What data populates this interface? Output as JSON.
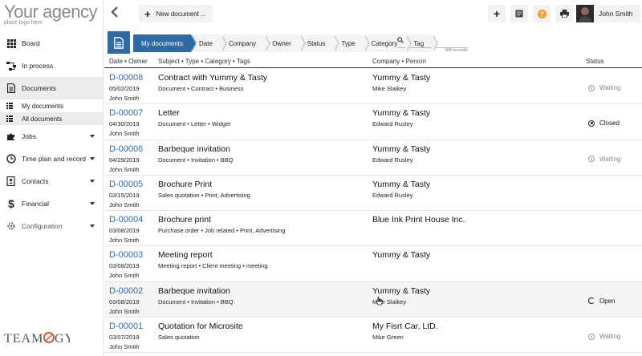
{
  "brand": {
    "name": "Your agency",
    "subtitle": "place logo here"
  },
  "sidebar": {
    "items": [
      {
        "label": "Board",
        "icon": "grid-icon"
      },
      {
        "label": "In process",
        "icon": "flow-icon"
      },
      {
        "label": "Documents",
        "icon": "document-icon",
        "active": true
      },
      {
        "label": "Jobs",
        "icon": "puzzle-icon"
      },
      {
        "label": "Time plan and record",
        "icon": "clock-icon"
      },
      {
        "label": "Contacts",
        "icon": "contacts-icon"
      },
      {
        "label": "Financial",
        "icon": "dollar-icon"
      },
      {
        "label": "Configuration",
        "icon": "gear-icon"
      }
    ],
    "subitems": [
      {
        "label": "My documents"
      },
      {
        "label": "All documents",
        "active": true
      }
    ],
    "footer_logo": "TEAMOGY"
  },
  "topbar": {
    "new_document_label": "New document ...",
    "user_name": "John Smith"
  },
  "filters": {
    "crumbs": [
      "My documents",
      "Date",
      "Company",
      "Owner",
      "Status",
      "Type",
      "Category",
      "Tag"
    ],
    "records": "8/8 records"
  },
  "table": {
    "headers": {
      "col1": "Date • Owner",
      "col2": "Subject • Type • Category • Tags",
      "col3": "Company • Person",
      "col4": "Status"
    },
    "rows": [
      {
        "id": "D-00008",
        "date": "05/02/2019",
        "owner": "John Smith",
        "subject": "Contract with Yummy & Tasty",
        "meta": "Document • Contract • Business",
        "company": "Yummy & Tasty",
        "person": "Mike Slaikey",
        "status": "Waiting",
        "status_kind": "waiting"
      },
      {
        "id": "D-00007",
        "date": "04/30/2019",
        "owner": "John Smith",
        "subject": "Letter",
        "meta": "Document • Letter • Widget",
        "company": "Yummy & Tasty",
        "person": "Edward Rusley",
        "status": "Closed",
        "status_kind": "closed"
      },
      {
        "id": "D-00006",
        "date": "04/29/2019",
        "owner": "John Smith",
        "subject": "Barbeque invitation",
        "meta": "Document • Invitation • BBQ",
        "company": "Yummy & Tasty",
        "person": "Edward Rusley",
        "status": "Waiting",
        "status_kind": "waiting"
      },
      {
        "id": "D-00005",
        "date": "03/15/2019",
        "owner": "John Smith",
        "subject": "Brochure Print",
        "meta": "Sales quotation • Print, Advertising",
        "company": "Yummy & Tasty",
        "person": "Edward Rusley",
        "status": "",
        "status_kind": "none"
      },
      {
        "id": "D-00004",
        "date": "03/08/2019",
        "owner": "John Smith",
        "subject": "Brochure print",
        "meta": "Purchase order • Job related • Print, Advertising",
        "company": "Blue Ink Print House Inc.",
        "person": "",
        "status": "",
        "status_kind": "none"
      },
      {
        "id": "D-00003",
        "date": "03/08/2019",
        "owner": "John Smith",
        "subject": "Meeting report",
        "meta": "Meeting report • Client meeting • meeting",
        "company": "Yummy & Tasty",
        "person": "",
        "status": "",
        "status_kind": "none"
      },
      {
        "id": "D-00002",
        "date": "03/08/2019",
        "owner": "John Smith",
        "subject": "Barbeque invitation",
        "meta": "Document • Invitation • BBQ",
        "company": "Yummy & Tasty",
        "person": "Mike Slaikey",
        "status": "Open",
        "status_kind": "open"
      },
      {
        "id": "D-00001",
        "date": "03/07/2019",
        "owner": "John Smith",
        "subject": "Quotation for Microsite",
        "meta": "Sales quotation",
        "company": "My Fisrt Car, LtD.",
        "person": "Mike Green",
        "status": "Waiting",
        "status_kind": "waiting"
      }
    ]
  },
  "colors": {
    "accent": "#2d6aa6",
    "help": "#f0a020"
  }
}
